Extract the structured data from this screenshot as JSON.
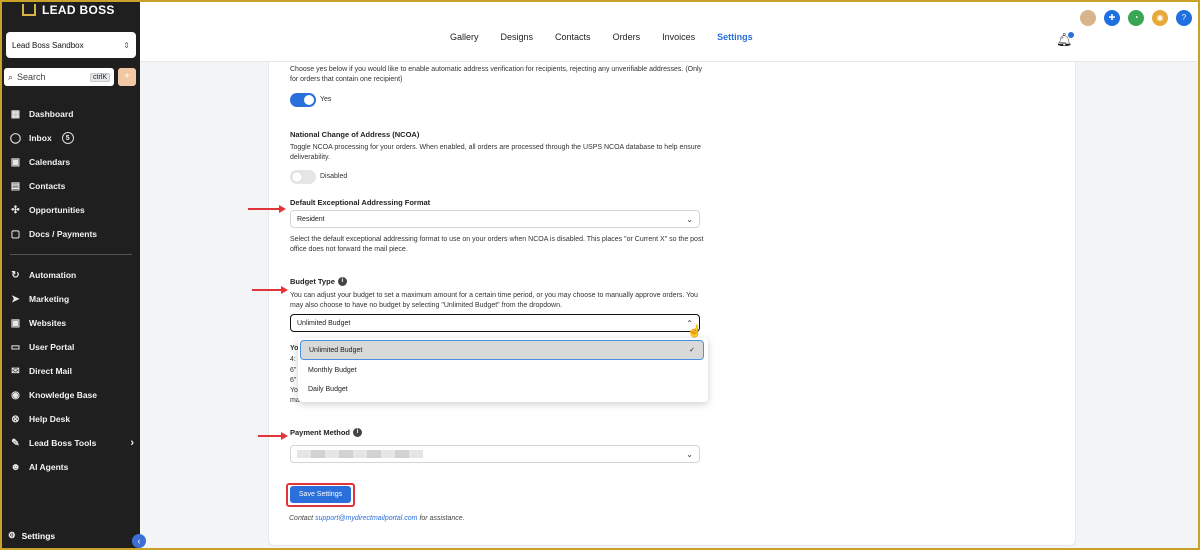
{
  "app": {
    "logo_text": "LEAD BOSS"
  },
  "sidebar": {
    "account": "Lead Boss Sandbox",
    "search": {
      "placeholder": "Search",
      "shortcut": "ctrlK"
    },
    "items": [
      {
        "label": "Dashboard",
        "icon": "grid-icon"
      },
      {
        "label": "Inbox",
        "icon": "chat-icon",
        "badge": "5"
      },
      {
        "label": "Calendars",
        "icon": "calendar-icon"
      },
      {
        "label": "Contacts",
        "icon": "contacts-icon"
      },
      {
        "label": "Opportunities",
        "icon": "opportunities-icon"
      },
      {
        "label": "Docs / Payments",
        "icon": "docs-icon"
      }
    ],
    "items2": [
      {
        "label": "Automation",
        "icon": "automation-icon"
      },
      {
        "label": "Marketing",
        "icon": "send-icon"
      },
      {
        "label": "Websites",
        "icon": "websites-icon"
      },
      {
        "label": "User Portal",
        "icon": "monitor-icon"
      },
      {
        "label": "Direct Mail",
        "icon": "mail-icon"
      },
      {
        "label": "Knowledge Base",
        "icon": "knowledge-icon"
      },
      {
        "label": "Help Desk",
        "icon": "help-desk-icon"
      },
      {
        "label": "Lead Boss Tools",
        "icon": "tools-icon"
      },
      {
        "label": "AI Agents",
        "icon": "robot-icon"
      }
    ],
    "settings": "Settings"
  },
  "topbar": {
    "tabs": [
      "Gallery",
      "Designs",
      "Contacts",
      "Orders",
      "Invoices",
      "Settings"
    ],
    "active_tab": "Settings"
  },
  "content": {
    "address_verification_desc": "Choose yes below if you would like to enable automatic address verification for recipients, rejecting any unverifiable addresses. (Only for orders that contain one recipient)",
    "address_verification_state": "Yes",
    "ncoa_title": "National Change of Address (NCOA)",
    "ncoa_desc": "Toggle NCOA processing for your orders. When enabled, all orders are processed through the USPS NCOA database to help ensure deliverability.",
    "ncoa_state": "Disabled",
    "exceptional_title": "Default Exceptional Addressing Format",
    "exceptional_value": "Resident",
    "exceptional_desc": "Select the default exceptional addressing format to use on your orders when NCOA is disabled. This places \"or Current X\" so the post office does not forward the mail piece.",
    "budget_title": "Budget Type",
    "budget_desc": "You can adjust your budget to set a maximum amount for a certain time period, or you may choose to manually approve orders. You may also choose to have no budget by selecting \"Unlimited Budget\" from the dropdown.",
    "budget_value": "Unlimited Budget",
    "budget_options": [
      "Unlimited Budget",
      "Monthly Budget",
      "Daily Budget"
    ],
    "hidden_fragments": [
      "Yo",
      "4:",
      "6\"",
      "6\"",
      "Yo",
      "ma"
    ],
    "payment_title": "Payment Method",
    "save_button": "Save Settings",
    "contact_prefix": "Contact",
    "contact_email": "support@mydirectmailportal.com",
    "contact_suffix": "for assistance."
  }
}
